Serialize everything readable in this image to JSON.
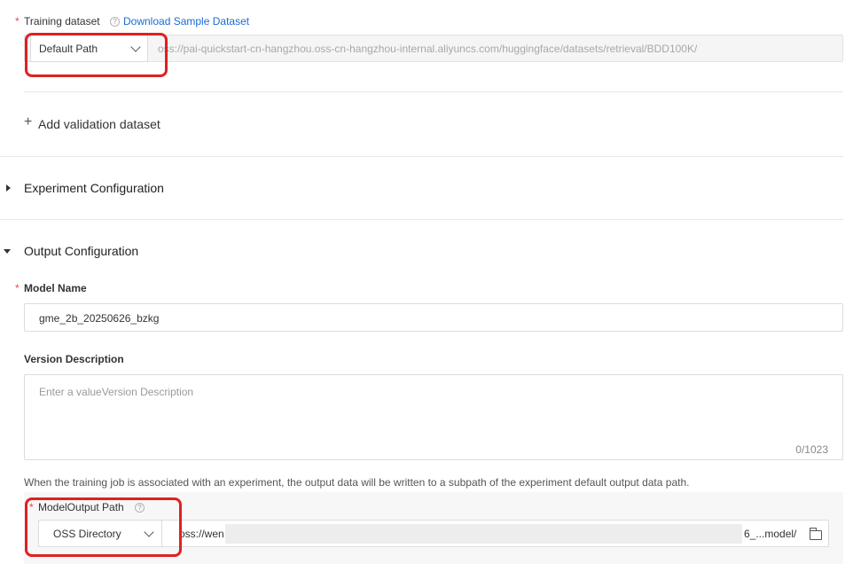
{
  "training_dataset": {
    "required_mark": "*",
    "label": "Training dataset",
    "help_icon": "?",
    "download_link": "Download Sample Dataset",
    "source_select": "Default Path",
    "path_value": "oss://pai-quickstart-cn-hangzhou.oss-cn-hangzhou-internal.aliyuncs.com/huggingface/datasets/retrieval/BDD100K/"
  },
  "add_validation": {
    "icon": "+",
    "label": "Add validation dataset"
  },
  "experiment_section": {
    "title": "Experiment Configuration"
  },
  "output_section": {
    "title": "Output Configuration",
    "model_name": {
      "required_mark": "*",
      "label": "Model Name",
      "value": "gme_2b_20250626_bzkg"
    },
    "version_description": {
      "label": "Version Description",
      "placeholder": "Enter a valueVersion Description",
      "counter": "0/1023"
    },
    "note": "When the training job is associated with an experiment, the output data will be written to a subpath of the experiment default output data path.",
    "model_output_path": {
      "required_mark": "*",
      "label": "ModelOutput Path",
      "help_icon": "?",
      "source_select": "OSS Directory",
      "path_prefix": "oss://wen",
      "path_suffix": "6_...model/"
    }
  },
  "colors": {
    "highlight": "#e02020",
    "link": "#1a6bd6",
    "required": "#e5484d"
  },
  "icons": {
    "chevron": "chevron-down-icon",
    "folder": "folder-icon",
    "collapsed": "caret-right-icon",
    "expanded": "caret-down-icon"
  }
}
